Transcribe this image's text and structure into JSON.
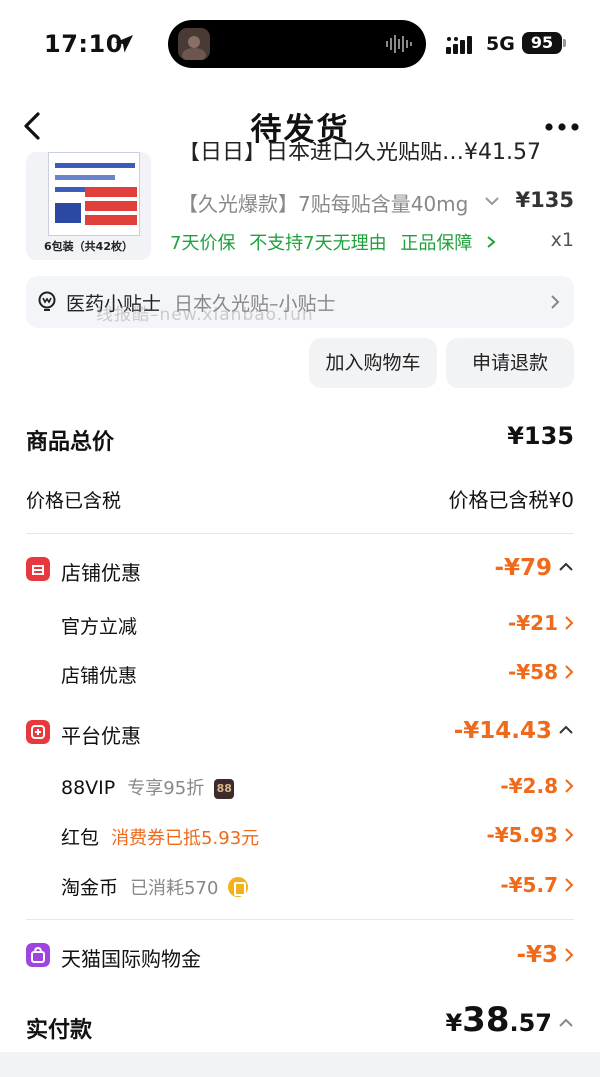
{
  "status_bar": {
    "time": "17:10",
    "network": "5G",
    "battery": "95"
  },
  "nav": {
    "title": "待发货"
  },
  "product": {
    "title_partial": "【日日】日本进口久光贴贴…¥41.57",
    "image_caption": "6包装（共42枚）",
    "spec": "【久光爆款】7贴每贴含量40mg",
    "price": "¥135",
    "tags": [
      "7天价保",
      "不支持7天无理由",
      "正品保障"
    ],
    "quantity": "x1"
  },
  "tip": {
    "label": "医药小贴士",
    "text": "日本久光贴–小贴士"
  },
  "watermark": "线报酷–new.xianbao.fun",
  "actions": {
    "add_to_cart": "加入购物车",
    "refund": "申请退款"
  },
  "summary": {
    "total_label": "商品总价",
    "total_value": "¥135",
    "tax_label": "价格已含税",
    "tax_value": "价格已含税¥0"
  },
  "store_discount": {
    "label": "店铺优惠",
    "value": "-¥79",
    "items": [
      {
        "label": "官方立减",
        "value": "-¥21"
      },
      {
        "label": "店铺优惠",
        "value": "-¥58"
      }
    ]
  },
  "platform_discount": {
    "label": "平台优惠",
    "value": "-¥14.43",
    "vip_label": "88VIP",
    "vip_note": "专享95折",
    "vip_badge": "88",
    "vip_value": "-¥2.8",
    "redpacket_label": "红包",
    "redpacket_note": "消费券已抵5.93元",
    "redpacket_value": "-¥5.93",
    "coin_label": "淘金币",
    "coin_note": "已消耗570",
    "coin_value": "-¥5.7"
  },
  "tmall_global": {
    "label": "天猫国际购物金",
    "value": "-¥3"
  },
  "paid": {
    "label": "实付款",
    "currency": "¥",
    "integer": "38",
    "decimal": ".57"
  },
  "colors": {
    "accent_orange": "#ef6a1a",
    "green": "#1fa23c",
    "store_red": "#e8383d",
    "purple": "#a044e0"
  }
}
